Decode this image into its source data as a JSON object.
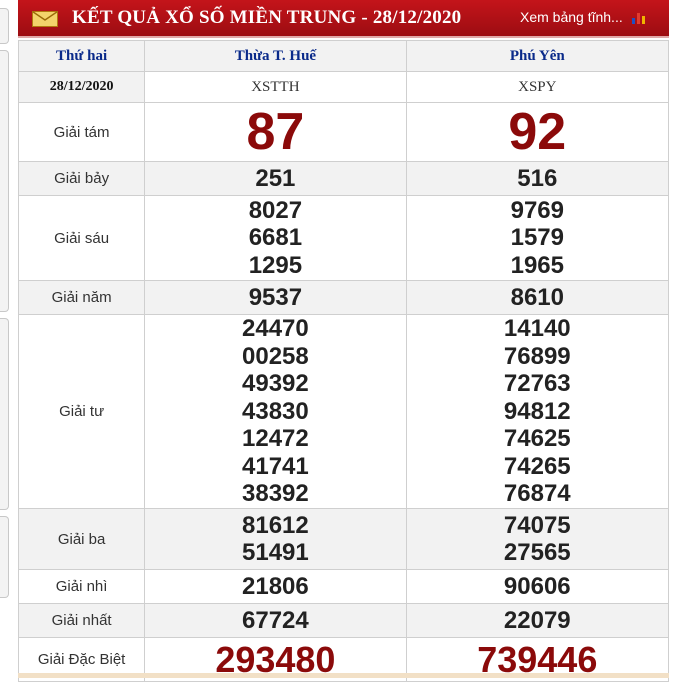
{
  "header": {
    "title": "KẾT QUẢ XỔ SỐ MIỀN TRUNG - 28/12/2020",
    "link": "Xem bảng tĩnh..."
  },
  "table": {
    "day": "Thứ hai",
    "date": "28/12/2020",
    "provinces": [
      {
        "name": "Thừa T. Huế",
        "code": "XSTTH"
      },
      {
        "name": "Phú Yên",
        "code": "XSPY"
      }
    ],
    "prizes": [
      {
        "label": "Giải tám",
        "values": [
          [
            "87"
          ],
          [
            "92"
          ]
        ]
      },
      {
        "label": "Giải bảy",
        "values": [
          [
            "251"
          ],
          [
            "516"
          ]
        ]
      },
      {
        "label": "Giải sáu",
        "values": [
          [
            "8027",
            "6681",
            "1295"
          ],
          [
            "9769",
            "1579",
            "1965"
          ]
        ]
      },
      {
        "label": "Giải năm",
        "values": [
          [
            "9537"
          ],
          [
            "8610"
          ]
        ]
      },
      {
        "label": "Giải tư",
        "values": [
          [
            "24470",
            "00258",
            "49392",
            "43830",
            "12472",
            "41741",
            "38392"
          ],
          [
            "14140",
            "76899",
            "72763",
            "94812",
            "74625",
            "74265",
            "76874"
          ]
        ]
      },
      {
        "label": "Giải ba",
        "values": [
          [
            "81612",
            "51491"
          ],
          [
            "74075",
            "27565"
          ]
        ]
      },
      {
        "label": "Giải nhì",
        "values": [
          [
            "21806"
          ],
          [
            "90606"
          ]
        ]
      },
      {
        "label": "Giải nhất",
        "values": [
          [
            "67724"
          ],
          [
            "22079"
          ]
        ]
      },
      {
        "label": "Giải Đặc Biệt",
        "values": [
          [
            "293480"
          ],
          [
            "739446"
          ]
        ]
      }
    ]
  },
  "colors": {
    "header_bg": "#b0111a",
    "highlight": "#8b0a0a",
    "province": "#0a2a8a"
  },
  "icons": [
    "envelope-icon",
    "bar-chart-icon"
  ]
}
